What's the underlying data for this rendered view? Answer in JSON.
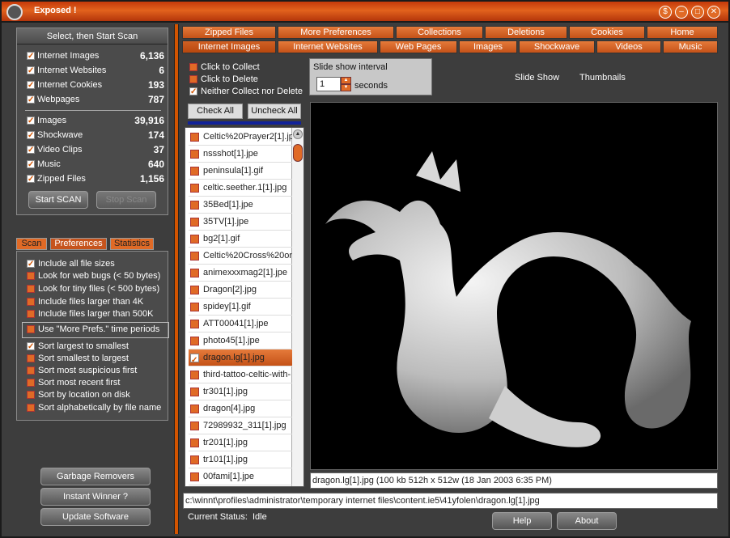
{
  "app": {
    "title": "Exposed !"
  },
  "summary": {
    "header": "Select, then Start Scan",
    "group1": [
      {
        "label": "Internet Images",
        "value": "6,136"
      },
      {
        "label": "Internet Websites",
        "value": "6"
      },
      {
        "label": "Internet Cookies",
        "value": "193"
      },
      {
        "label": "Webpages",
        "value": "787"
      }
    ],
    "group2": [
      {
        "label": "Images",
        "value": "39,916"
      },
      {
        "label": "Shockwave",
        "value": "174"
      },
      {
        "label": "Video Clips",
        "value": "37"
      },
      {
        "label": "Music",
        "value": "640"
      },
      {
        "label": "Zipped Files",
        "value": "1,156"
      }
    ],
    "start_label": "Start SCAN",
    "stop_label": "Stop Scan"
  },
  "left_tabs": [
    "Scan",
    "Preferences",
    "Statistics"
  ],
  "prefs": {
    "items": [
      "Include all file sizes",
      "Look for web bugs (< 50 bytes)",
      "Look for tiny files (< 500 bytes)",
      "Include files larger than 4K",
      "Include files larger than 500K",
      "Use \"More Prefs.\" time periods"
    ],
    "sort": [
      "Sort largest to smallest",
      "Sort smallest to largest",
      "Sort most suspicious first",
      "Sort most recent first",
      "Sort by location on disk",
      "Sort alphabetically by file name"
    ]
  },
  "bottom_buttons": [
    "Garbage Removers",
    "Instant Winner ?",
    "Update Software"
  ],
  "tabs_row1": [
    "Zipped Files",
    "More Preferences",
    "Collections",
    "Deletions",
    "Cookies",
    "Home"
  ],
  "tabs_row2": [
    "Internet Images",
    "Internet Websites",
    "Web Pages",
    "Images",
    "Shockwave",
    "Videos",
    "Music"
  ],
  "actions": [
    "Click to Collect",
    "Click to Delete",
    "Neither Collect nor Delete"
  ],
  "slideshow": {
    "label": "Slide show interval",
    "value": "1",
    "unit": "seconds",
    "slide_show": "Slide Show",
    "thumbnails": "Thumbnails"
  },
  "list_buttons": {
    "check_all": "Check All",
    "uncheck_all": "Uncheck All"
  },
  "files": [
    "Celtic%20Prayer2[1].jp",
    "nssshot[1].jpe",
    "peninsula[1].gif",
    "celtic.seether.1[1].jpg",
    "35Bed[1].jpe",
    "35TV[1].jpe",
    "bg2[1].gif",
    "Celtic%20Cross%20or",
    "animexxxmag2[1].jpe",
    "Dragon[2].jpg",
    "spidey[1].gif",
    "ATT00041[1].jpe",
    "photo45[1].jpe",
    "dragon.lg[1].jpg",
    "third-tattoo-celtic-with-",
    "tr301[1].jpg",
    "dragon[4].jpg",
    "72989932_311[1].jpg",
    "tr201[1].jpg",
    "tr101[1].jpg",
    "00fami[1].jpe"
  ],
  "caption": "dragon.lg[1].jpg    (100 kb  512h x 512w   (18 Jan 2003  6:35 PM)",
  "path": "c:\\winnt\\profiles\\administrator\\temporary internet files\\content.ie5\\41yfolen\\dragon.lg[1].jpg",
  "status": {
    "label": "Current Status:",
    "value": "Idle"
  },
  "footer": {
    "help": "Help",
    "about": "About"
  }
}
